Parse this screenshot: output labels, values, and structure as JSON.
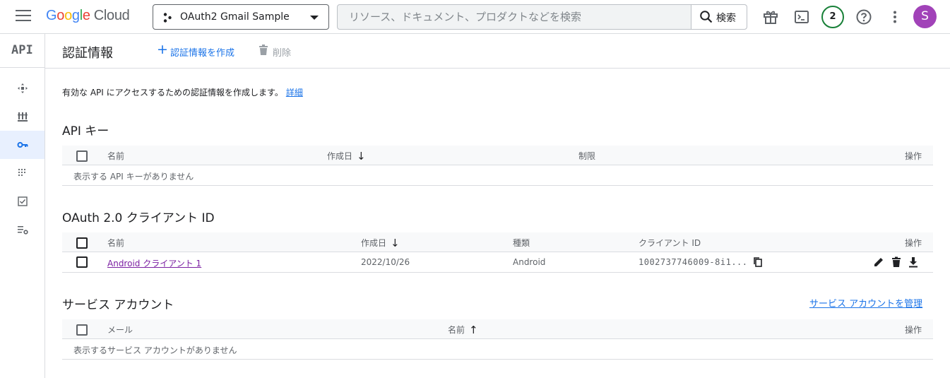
{
  "header": {
    "logo_google": "Google",
    "logo_cloud": "Cloud",
    "project_name": "OAuth2 Gmail Sample",
    "search_placeholder": "リソース、ドキュメント、プロダクトなどを検索",
    "search_button_label": "検索",
    "notification_count": "2",
    "avatar_initial": "S"
  },
  "rail": {
    "title": "API",
    "items": [
      "dashboard-icon",
      "library-icon",
      "key-icon",
      "consent-icon",
      "agreement-icon",
      "settings-icon"
    ],
    "active_index": 2
  },
  "page": {
    "title": "認証情報",
    "create_label": "認証情報を作成",
    "delete_label": "削除",
    "intro_text": "有効な API にアクセスするための認証情報を作成します。",
    "intro_link": "詳細"
  },
  "api_keys": {
    "title": "API キー",
    "columns": [
      "名前",
      "作成日",
      "制限",
      "操作"
    ],
    "empty_text": "表示する API キーがありません"
  },
  "oauth_clients": {
    "title": "OAuth 2.0 クライアント ID",
    "columns": [
      "名前",
      "作成日",
      "種類",
      "クライアント ID",
      "操作"
    ],
    "rows": [
      {
        "name": "Android クライアント 1",
        "created": "2022/10/26",
        "type": "Android",
        "client_id": "1002737746009-8i1..."
      }
    ]
  },
  "service_accounts": {
    "title": "サービス アカウント",
    "manage_link": "サービス アカウントを管理",
    "columns": [
      "メール",
      "名前",
      "操作"
    ],
    "empty_text": "表示するサービス アカウントがありません"
  },
  "colors": {
    "accent": "#1a73e8",
    "visited_link": "#7b1fa2",
    "avatar": "#a142b8",
    "notification_ring": "#188038"
  }
}
